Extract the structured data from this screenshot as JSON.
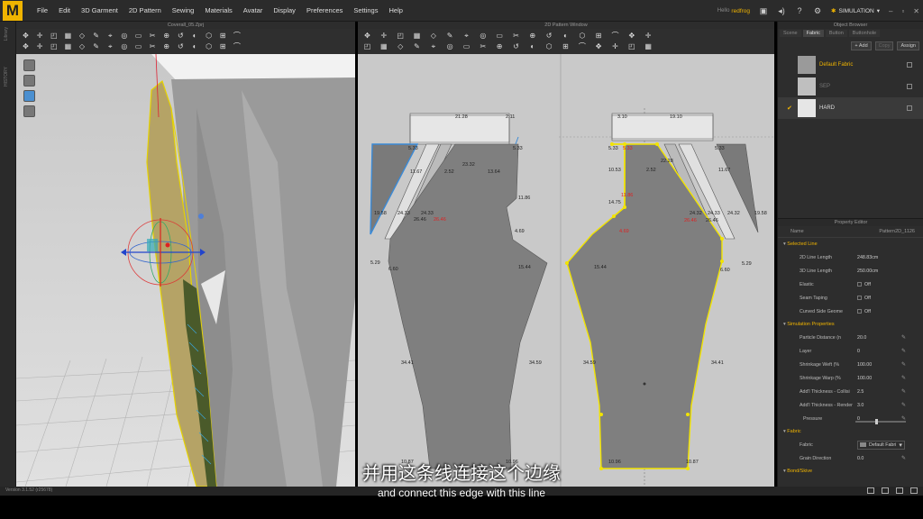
{
  "app": {
    "logo_letter": "M",
    "accent": "#f0b400"
  },
  "menu": [
    "File",
    "Edit",
    "3D Garment",
    "2D Pattern",
    "Sewing",
    "Materials",
    "Avatar",
    "Display",
    "Preferences",
    "Settings",
    "Help"
  ],
  "user": {
    "prefix": "Hello",
    "name": "redfrog"
  },
  "mode": {
    "label": "SIMULATION"
  },
  "left_strip": {
    "labels": [
      "Library",
      "HISTORY"
    ]
  },
  "window3d": {
    "title": "Coverall_05.Zprj"
  },
  "window2d": {
    "title": "2D Pattern Window"
  },
  "object_browser": {
    "title": "Object Browser",
    "tabs": [
      "Scene",
      "Fabric",
      "Button",
      "Buttonhole"
    ],
    "active_tab": "Fabric",
    "actions": [
      "+ Add",
      "Copy",
      "Assign"
    ],
    "fabrics": [
      {
        "name": "Default Fabric",
        "color": "#9a9a9a",
        "selected": false,
        "checked": false
      },
      {
        "name": "SEP",
        "color": "#bfbfbf",
        "selected": false,
        "checked": false
      },
      {
        "name": "HARD",
        "color": "#e6e6e6",
        "selected": true,
        "checked": true
      }
    ]
  },
  "property_editor": {
    "title": "Property Editor",
    "name_label": "Name",
    "name_value": "Pattern2D_1126",
    "sections": {
      "selected_line": "Selected Line",
      "simulation": "Simulation Properties",
      "fabric": "Fabric",
      "pressure": "Pressure"
    },
    "line_props": [
      {
        "k": "2D Line Length",
        "v": "248.83cm"
      },
      {
        "k": "3D Line Length",
        "v": "250.00cm"
      },
      {
        "k": "Elastic",
        "v": "Off"
      },
      {
        "k": "Seam Taping",
        "v": "Off"
      },
      {
        "k": "Curved Side Geome",
        "v": "Off"
      }
    ],
    "sim_props": [
      {
        "k": "Particle Distance (n",
        "v": "20.0"
      },
      {
        "k": "Layer",
        "v": "0"
      },
      {
        "k": "Shrinkage Weft (%",
        "v": "100.00"
      },
      {
        "k": "Shrinkage Warp (%",
        "v": "100.00"
      },
      {
        "k": "Add'l Thickness - Collisi",
        "v": "2.5"
      },
      {
        "k": "Add'l Thickness - Render",
        "v": "3.0"
      }
    ],
    "pressure_value": "0",
    "fabric_props": [
      {
        "k": "Fabric",
        "v": "Default Fabri"
      },
      {
        "k": "Grain Direction",
        "v": "0.0"
      }
    ],
    "more_section": "Bond/Skive"
  },
  "pattern_labels": {
    "top_left": [
      "21.28",
      "2.11",
      "5.33",
      "5.33",
      "23.32",
      "11.67",
      "2.52",
      "13.64",
      "11.86",
      "19.58",
      "24.33",
      "24.33",
      "26.46",
      "26.46",
      "4.69",
      "5.29",
      "6.60",
      "15.44",
      "34.41",
      "34.59",
      "10.87",
      "10.96"
    ],
    "top_right": [
      "3.10",
      "19.10",
      "5.33",
      "5.33",
      "5.33",
      "22.28",
      "10.53",
      "2.52",
      "11.67",
      "11.86",
      "14.75",
      "4.69",
      "24.32",
      "24.33",
      "24.32",
      "26.46",
      "26.46",
      "19.58",
      "6.60",
      "5.29",
      "15.44",
      "34.59",
      "34.41",
      "10.96",
      "10.87"
    ]
  },
  "status": {
    "version": "Version 3.1.52 (r25678)"
  },
  "subtitles": {
    "cn": "并用这条线连接这个边缘",
    "en": "and connect this edge with this line"
  }
}
